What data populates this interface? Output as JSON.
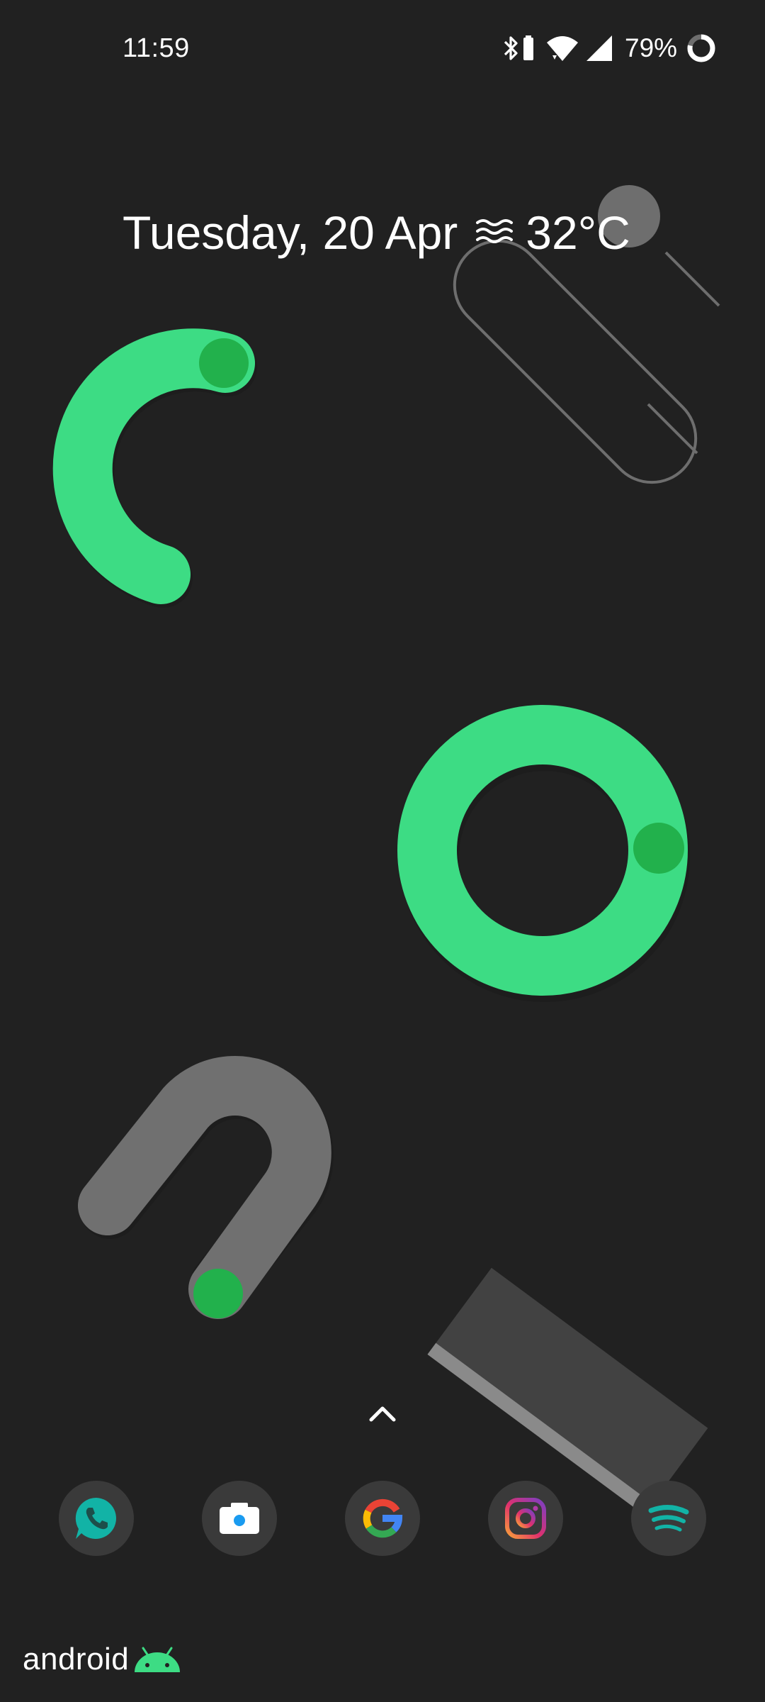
{
  "status_bar": {
    "time": "11:59",
    "battery_percent": "79%",
    "icons": [
      "bluetooth-icon",
      "battery-saver-icon",
      "wifi-icon",
      "cell-signal-icon",
      "battery-ring-icon"
    ]
  },
  "at_a_glance": {
    "date": "Tuesday, 20 Apr",
    "weather_icon": "haze-icon",
    "temperature": "32°C"
  },
  "app_drawer_handle": {
    "icon": "chevron-up-icon"
  },
  "dock": {
    "apps": [
      {
        "name": "Phone",
        "icon": "phone-icon"
      },
      {
        "name": "Camera",
        "icon": "camera-icon"
      },
      {
        "name": "Google",
        "icon": "google-icon"
      },
      {
        "name": "Instagram",
        "icon": "instagram-icon"
      },
      {
        "name": "Spotify",
        "icon": "spotify-icon"
      }
    ]
  },
  "branding": {
    "word": "android",
    "mark": "android-robot-icon"
  },
  "colors": {
    "background": "#212121",
    "accent_green": "#3ddc84",
    "dark_green": "#22b14c",
    "shape_gray": "#707070",
    "dock_circle": "#3a3a3a"
  }
}
